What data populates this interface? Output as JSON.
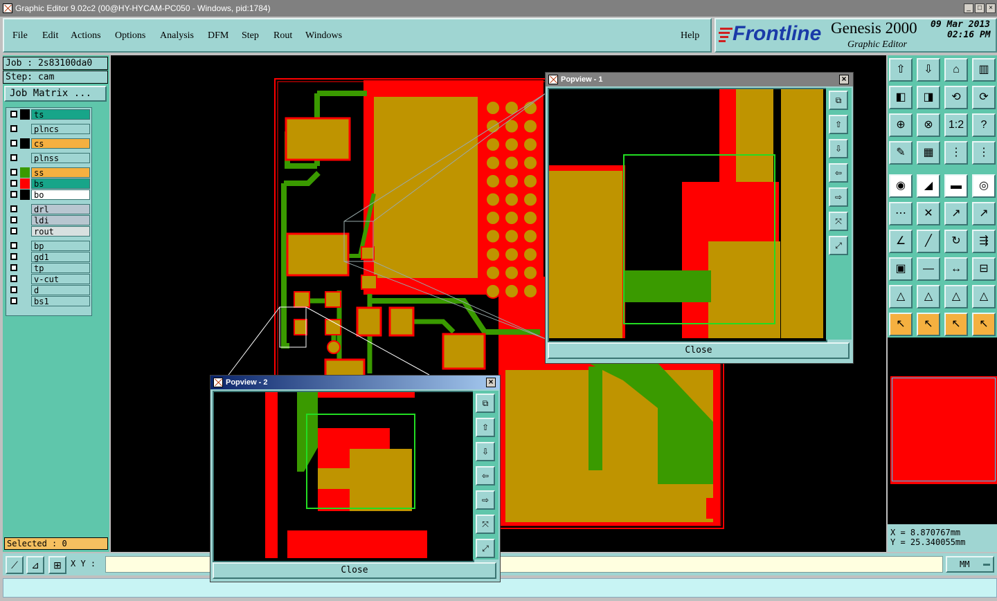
{
  "window": {
    "title": "Graphic Editor 9.02c2 (00@HY-HYCAM-PC050 - Windows, pid:1784)"
  },
  "menu": {
    "items": [
      {
        "label": "File"
      },
      {
        "label": "Edit"
      },
      {
        "label": "Actions"
      },
      {
        "label": "Options"
      },
      {
        "label": "Analysis"
      },
      {
        "label": "DFM"
      },
      {
        "label": "Step"
      },
      {
        "label": "Rout"
      },
      {
        "label": "Windows"
      }
    ],
    "help": "Help"
  },
  "brand": {
    "logo": "Frontline",
    "product": "Genesis 2000",
    "subtitle": "Graphic Editor",
    "date": "09 Mar 2013",
    "time": "02:16 PM"
  },
  "job": {
    "job_label": "Job : 2s83100da0",
    "step_label": "Step: cam",
    "matrix_button": "Job Matrix ..."
  },
  "layers": [
    {
      "name": "ts",
      "swatch": "#000000",
      "bg": "#17a589"
    },
    {
      "name": "plncs",
      "swatch": "#9fd5d2",
      "bg": "#9fd5d2"
    },
    {
      "name": "cs",
      "swatch": "#000000",
      "bg": "#f5b040"
    },
    {
      "name": "plnss",
      "swatch": "#9fd5d2",
      "bg": "#9fd5d2"
    },
    {
      "name": "ss",
      "swatch": "#3a9a00",
      "bg": "#f5b040"
    },
    {
      "name": "bs",
      "swatch": "#ff0000",
      "bg": "#17a589"
    },
    {
      "name": "bo",
      "swatch": "#000000",
      "bg": "#ffffff"
    },
    {
      "name": "drl",
      "swatch": "#9fd5d2",
      "bg": "#b8c6d0"
    },
    {
      "name": "ldi",
      "swatch": "#9fd5d2",
      "bg": "#b8c6d0"
    },
    {
      "name": "rout",
      "swatch": "#9fd5d2",
      "bg": "#d8e0e0"
    },
    {
      "name": "bp",
      "swatch": "#9fd5d2",
      "bg": "#9fd5d2"
    },
    {
      "name": "gd1",
      "swatch": "#9fd5d2",
      "bg": "#9fd5d2"
    },
    {
      "name": "tp",
      "swatch": "#9fd5d2",
      "bg": "#9fd5d2"
    },
    {
      "name": "v-cut",
      "swatch": "#9fd5d2",
      "bg": "#9fd5d2"
    },
    {
      "name": "d",
      "swatch": "#9fd5d2",
      "bg": "#9fd5d2"
    },
    {
      "name": "bs1",
      "swatch": "#9fd5d2",
      "bg": "#9fd5d2"
    }
  ],
  "selection": {
    "label": "Selected : 0"
  },
  "popview1": {
    "title": "Popview - 1",
    "close_label": "Close"
  },
  "popview2": {
    "title": "Popview - 2",
    "close_label": "Close"
  },
  "coords": {
    "x_label": "X = 8.870767mm",
    "y_label": "Y = 25.340055mm"
  },
  "bottom": {
    "xy_label": "X Y :",
    "xy_value": "",
    "units": "MM"
  },
  "colors": {
    "copper": "#bf9400",
    "mask": "#ff0000",
    "trace": "#3a9a00",
    "panel": "#9fd5d2",
    "panel_dark": "#5fc6ab"
  },
  "toolbox": {
    "icons": [
      "open-step-icon",
      "save-icon",
      "home-icon",
      "layout-icon",
      "prev-icon",
      "next-icon",
      "undo-icon",
      "redo-icon",
      "fit-icon",
      "zoom-icon",
      "scale-1-2-icon",
      "help-icon",
      "measure-tool-icon",
      "grid-icon",
      "layer-red-icon",
      "layer-red2-icon",
      "pad-icon",
      "line-icon",
      "ruler-icon",
      "circle-icon",
      "connect-icon",
      "cross-icon",
      "node-icon",
      "node-red-icon",
      "angle-icon",
      "slash-icon",
      "arc-icon",
      "flip-icon",
      "pad-small-icon",
      "dash-icon",
      "dimension-icon",
      "group-icon",
      "tri-red-icon",
      "tri-icon",
      "tri-blue-icon",
      "tri-blue2-icon",
      "select-icon",
      "select-box-icon",
      "select-circle-icon",
      "select-poly-icon"
    ]
  }
}
